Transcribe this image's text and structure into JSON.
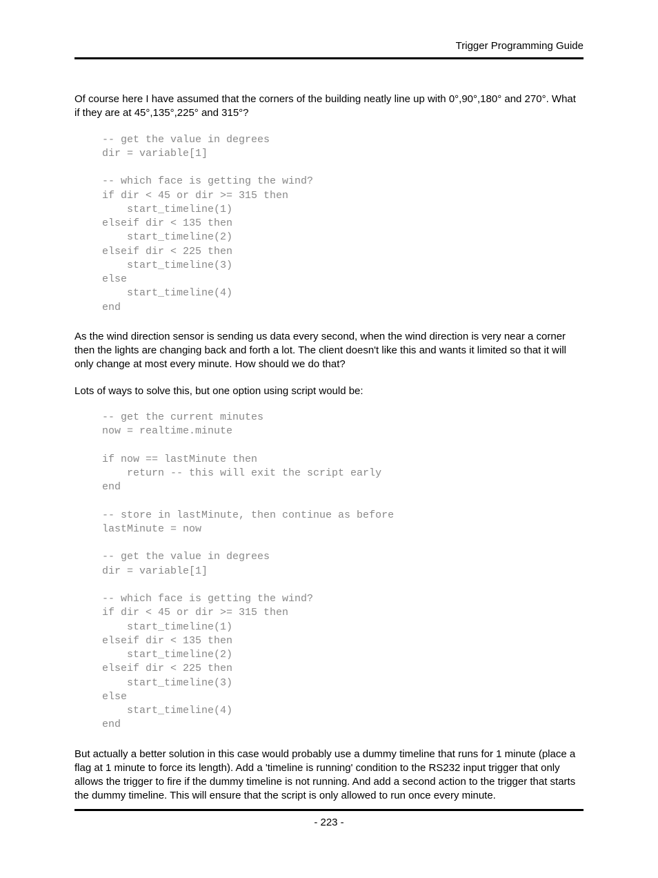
{
  "header": {
    "title": "Trigger Programming Guide"
  },
  "paragraphs": {
    "p1": "Of course here I have assumed that the corners of the building neatly line up with 0°,90°,180° and 270°. What if they are at 45°,135°,225° and 315°?",
    "p2": "As the wind direction sensor is sending us data every second, when the wind direction is very near a corner then the lights are changing back and forth a lot. The client doesn't like this and wants it limited so that it will only change at most every minute. How should we do that?",
    "p3": "Lots of ways to solve this, but one option using script would be:",
    "p4": "But actually a better solution in this case would probably use a dummy timeline that runs for 1 minute (place a flag at 1 minute to force its length). Add a 'timeline is running' condition to the RS232 input trigger that only allows the trigger to fire if the dummy timeline is not running. And add a second action to the trigger that starts the dummy timeline. This will ensure that the script is only allowed to run once every minute."
  },
  "code": {
    "block1": "-- get the value in degrees\ndir = variable[1]\n\n-- which face is getting the wind?\nif dir < 45 or dir >= 315 then\n    start_timeline(1)\nelseif dir < 135 then\n    start_timeline(2)\nelseif dir < 225 then\n    start_timeline(3)\nelse\n    start_timeline(4)\nend",
    "block2": "-- get the current minutes\nnow = realtime.minute\n\nif now == lastMinute then\n    return -- this will exit the script early\nend\n\n-- store in lastMinute, then continue as before\nlastMinute = now\n\n-- get the value in degrees\ndir = variable[1]\n\n-- which face is getting the wind?\nif dir < 45 or dir >= 315 then\n    start_timeline(1)\nelseif dir < 135 then\n    start_timeline(2)\nelseif dir < 225 then\n    start_timeline(3)\nelse\n    start_timeline(4)\nend"
  },
  "footer": {
    "page_number": "- 223 -"
  }
}
